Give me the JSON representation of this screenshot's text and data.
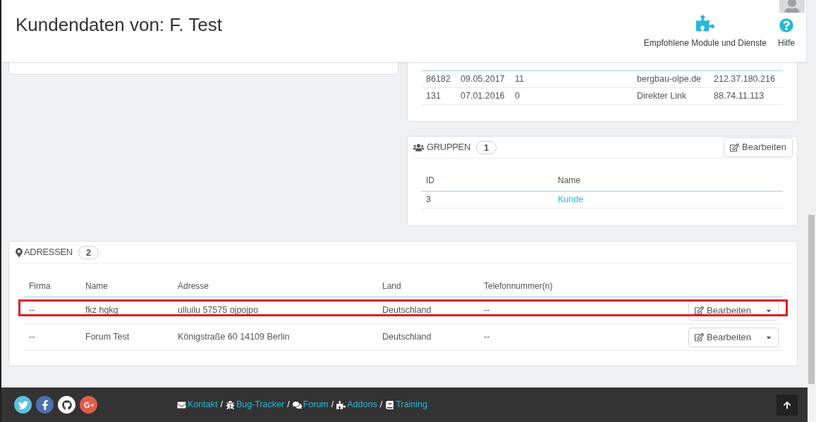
{
  "header": {
    "title": "Kundendaten von: F. Test",
    "actions": [
      {
        "label": "Empfohlene Module und Dienste",
        "kind": "puzzle"
      },
      {
        "label": "Hilfe",
        "kind": "help"
      }
    ]
  },
  "visits": {
    "rows": [
      [
        "86182",
        "09.05.2017",
        "11",
        "",
        "bergbau-olpe.de",
        "212.37.180.216"
      ],
      [
        "131",
        "07.01.2016",
        "0",
        "",
        "Direkter Link",
        "88.74.11.113"
      ]
    ]
  },
  "groups": {
    "title": "GRUPPEN",
    "count": "1",
    "edit": "Bearbeiten",
    "columns": [
      "ID",
      "Name"
    ],
    "rows": [
      [
        "3",
        "Kunde"
      ]
    ]
  },
  "addresses": {
    "title": "ADRESSEN",
    "count": "2",
    "columns": [
      "Firma",
      "Name",
      "Adresse",
      "Land",
      "Telefonnummer(n)"
    ],
    "rows": [
      {
        "cells": [
          "--",
          "fkz hgkg",
          "ulluilu 57575 ojpojpo",
          "Deutschland",
          "--"
        ],
        "action": "Bearbeiten",
        "highlighted": true
      },
      {
        "cells": [
          "--",
          "Forum Test",
          "Königstraße 60 14109 Berlin",
          "Deutschland",
          "--"
        ],
        "action": "Bearbeiten",
        "highlighted": false
      }
    ]
  },
  "footer": {
    "links": [
      {
        "label": "Kontakt",
        "kind": "mail"
      },
      {
        "label": "Bug-Tracker",
        "kind": "bug"
      },
      {
        "label": "Forum",
        "kind": "chat"
      },
      {
        "label": "Addons",
        "kind": "puzzle"
      },
      {
        "label": "Training",
        "kind": "book"
      }
    ],
    "separator": "/",
    "socials": [
      {
        "kind": "twitter",
        "color": "#5bc0de"
      },
      {
        "kind": "facebook",
        "color": "#4d6fb3"
      },
      {
        "kind": "github",
        "color": "#ffffff"
      },
      {
        "kind": "gplus",
        "color": "#e05d4b"
      }
    ]
  }
}
